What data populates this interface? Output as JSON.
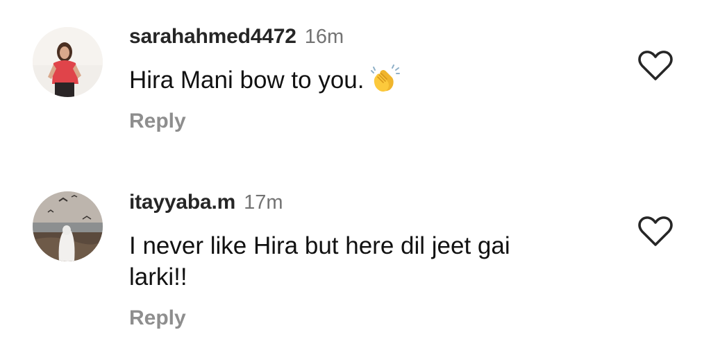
{
  "comments": [
    {
      "username": "sarahahmed4472",
      "time": "16m",
      "text": "Hira Mani bow to you.",
      "emoji": "clapping-hands",
      "reply_label": "Reply",
      "avatar": "profile-photo-woman-red-top",
      "like_icon": "heart-outline-icon"
    },
    {
      "username": "itayyaba.m",
      "time": "17m",
      "text": "I never like Hira but here dil jeet gai larki!!",
      "reply_label": "Reply",
      "avatar": "profile-photo-beach-birds",
      "like_icon": "heart-outline-icon"
    }
  ],
  "colors": {
    "username": "#262626",
    "timestamp": "#737373",
    "reply": "#8e8e8e",
    "text": "#111111",
    "icon": "#262626"
  }
}
